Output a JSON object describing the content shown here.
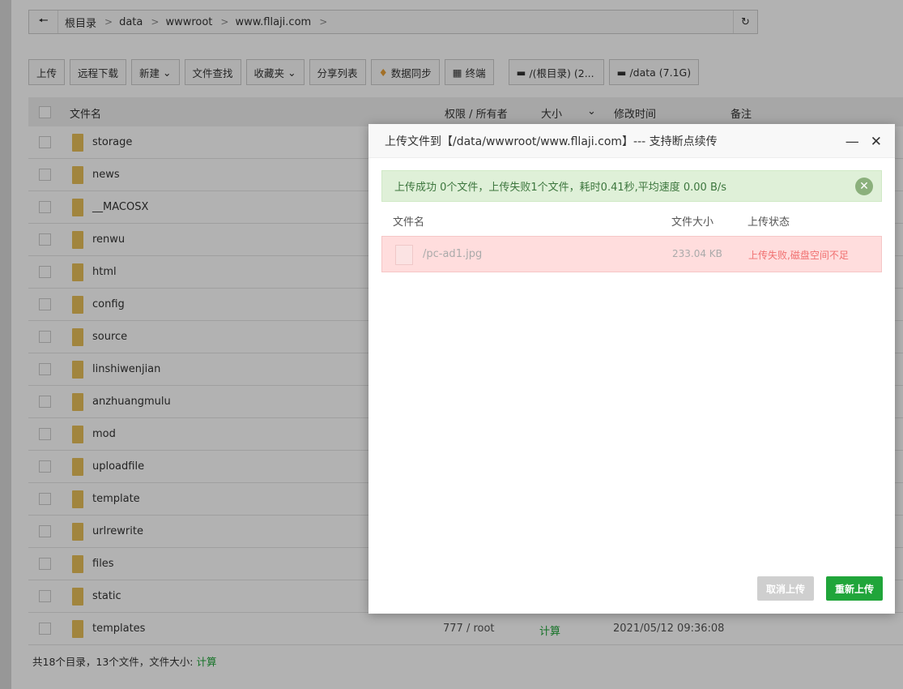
{
  "breadcrumb": [
    "根目录",
    "data",
    "wwwroot",
    "www.fllaji.com"
  ],
  "toolbar": {
    "upload": "上传",
    "remote_download": "远程下载",
    "new": "新建",
    "file_search": "文件查找",
    "favorites": "收藏夹",
    "share_list": "分享列表",
    "data_sync": "数据同步",
    "terminal": "终端",
    "disk_root": "/(根目录) (2...",
    "disk_data": "/data (7.1G)"
  },
  "table": {
    "headers": {
      "name": "文件名",
      "perm": "权限 / 所有者",
      "size": "大小",
      "mtime": "修改时间",
      "note": "备注"
    },
    "rows": [
      {
        "name": "storage"
      },
      {
        "name": "news"
      },
      {
        "name": "__MACOSX"
      },
      {
        "name": "renwu"
      },
      {
        "name": "html"
      },
      {
        "name": "config"
      },
      {
        "name": "source"
      },
      {
        "name": "linshiwenjian"
      },
      {
        "name": "anzhuangmulu"
      },
      {
        "name": "mod"
      },
      {
        "name": "uploadfile"
      },
      {
        "name": "template"
      },
      {
        "name": "urlrewrite"
      },
      {
        "name": "files"
      },
      {
        "name": "static"
      },
      {
        "name": "templates",
        "perm": "777 / root",
        "size": "计算",
        "mtime": "2021/05/12 09:36:08"
      }
    ]
  },
  "footer": {
    "summary": "共18个目录，13个文件，文件大小:",
    "calc": "计算"
  },
  "modal": {
    "title": "上传文件到【/data/wwwroot/www.fllaji.com】--- 支持断点续传",
    "alert": "上传成功 0个文件，上传失败1个文件，耗时0.41秒,平均速度 0.00 B/s",
    "headers": {
      "name": "文件名",
      "size": "文件大小",
      "status": "上传状态"
    },
    "file": {
      "name": "/pc-ad1.jpg",
      "size": "233.04 KB",
      "status": "上传失败,磁盘空间不足"
    },
    "cancel": "取消上传",
    "retry": "重新上传"
  }
}
